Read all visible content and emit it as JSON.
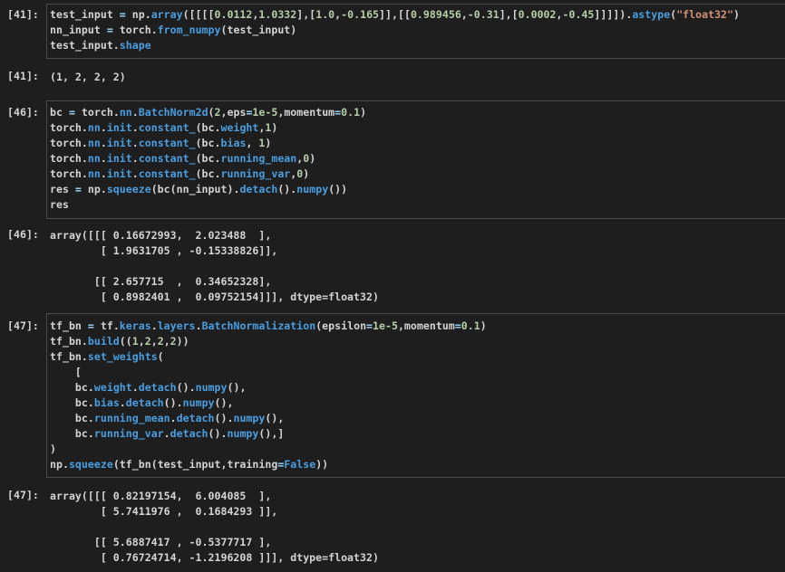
{
  "cells": [
    {
      "id": "in41",
      "prompt": "[41]:",
      "lines": [
        [
          [
            "test_input ",
            "def"
          ],
          [
            "=",
            "op"
          ],
          [
            " np.",
            "def"
          ],
          [
            "array",
            "fn"
          ],
          [
            "([[[[",
            "def"
          ],
          [
            "0.0112",
            "num"
          ],
          [
            ",",
            "def"
          ],
          [
            "1.0332",
            "num"
          ],
          [
            "],[",
            "def"
          ],
          [
            "1.0",
            "num"
          ],
          [
            ",",
            "def"
          ],
          [
            "-0.165",
            "num"
          ],
          [
            "]],[[",
            "def"
          ],
          [
            "0.989456",
            "num"
          ],
          [
            ",",
            "def"
          ],
          [
            "-0.31",
            "num"
          ],
          [
            "],[",
            "def"
          ],
          [
            "0.0002",
            "num"
          ],
          [
            ",",
            "def"
          ],
          [
            "-0.45",
            "num"
          ],
          [
            "]]]]).",
            "def"
          ],
          [
            "astype",
            "fn"
          ],
          [
            "(",
            "def"
          ],
          [
            "\"float32\"",
            "str"
          ],
          [
            ")",
            "def"
          ]
        ],
        [
          [
            "nn_input ",
            "def"
          ],
          [
            "=",
            "op"
          ],
          [
            " torch.",
            "def"
          ],
          [
            "from_numpy",
            "fn"
          ],
          [
            "(test_input)",
            "def"
          ]
        ],
        [
          [
            "test_input.",
            "def"
          ],
          [
            "shape",
            "fn"
          ]
        ]
      ]
    },
    {
      "id": "out41",
      "prompt": "[41]:",
      "lines": [
        "(1, 2, 2, 2)"
      ]
    },
    {
      "id": "in46",
      "prompt": "[46]:",
      "lines": [
        [
          [
            "bc ",
            "def"
          ],
          [
            "=",
            "op"
          ],
          [
            " torch.",
            "def"
          ],
          [
            "nn",
            "fn"
          ],
          [
            ".",
            "def"
          ],
          [
            "BatchNorm2d",
            "fn"
          ],
          [
            "(",
            "def"
          ],
          [
            "2",
            "num"
          ],
          [
            ",eps",
            "def"
          ],
          [
            "=",
            "op"
          ],
          [
            "1e-5",
            "num"
          ],
          [
            ",momentum",
            "def"
          ],
          [
            "=",
            "op"
          ],
          [
            "0.1",
            "num"
          ],
          [
            ")",
            "def"
          ]
        ],
        [
          [
            "torch.",
            "def"
          ],
          [
            "nn",
            "fn"
          ],
          [
            ".",
            "def"
          ],
          [
            "init",
            "fn"
          ],
          [
            ".",
            "def"
          ],
          [
            "constant_",
            "fn"
          ],
          [
            "(bc.",
            "def"
          ],
          [
            "weight",
            "fn"
          ],
          [
            ",",
            "def"
          ],
          [
            "1",
            "num"
          ],
          [
            ")",
            "def"
          ]
        ],
        [
          [
            "torch.",
            "def"
          ],
          [
            "nn",
            "fn"
          ],
          [
            ".",
            "def"
          ],
          [
            "init",
            "fn"
          ],
          [
            ".",
            "def"
          ],
          [
            "constant_",
            "fn"
          ],
          [
            "(bc.",
            "def"
          ],
          [
            "bias",
            "fn"
          ],
          [
            ", ",
            "def"
          ],
          [
            "1",
            "num"
          ],
          [
            ")",
            "def"
          ]
        ],
        [
          [
            "torch.",
            "def"
          ],
          [
            "nn",
            "fn"
          ],
          [
            ".",
            "def"
          ],
          [
            "init",
            "fn"
          ],
          [
            ".",
            "def"
          ],
          [
            "constant_",
            "fn"
          ],
          [
            "(bc.",
            "def"
          ],
          [
            "running_mean",
            "fn"
          ],
          [
            ",",
            "def"
          ],
          [
            "0",
            "num"
          ],
          [
            ")",
            "def"
          ]
        ],
        [
          [
            "torch.",
            "def"
          ],
          [
            "nn",
            "fn"
          ],
          [
            ".",
            "def"
          ],
          [
            "init",
            "fn"
          ],
          [
            ".",
            "def"
          ],
          [
            "constant_",
            "fn"
          ],
          [
            "(bc.",
            "def"
          ],
          [
            "running_var",
            "fn"
          ],
          [
            ",",
            "def"
          ],
          [
            "0",
            "num"
          ],
          [
            ")",
            "def"
          ]
        ],
        [
          [
            "res ",
            "def"
          ],
          [
            "=",
            "op"
          ],
          [
            " np.",
            "def"
          ],
          [
            "squeeze",
            "fn"
          ],
          [
            "(bc(nn_input).",
            "def"
          ],
          [
            "detach",
            "fn"
          ],
          [
            "().",
            "def"
          ],
          [
            "numpy",
            "fn"
          ],
          [
            "())",
            "def"
          ]
        ],
        [
          [
            "res",
            "def"
          ]
        ]
      ]
    },
    {
      "id": "out46",
      "prompt": "[46]:",
      "lines": [
        "array([[[ 0.16672993,  2.023488  ],",
        "        [ 1.9631705 , -0.15338826]],",
        "",
        "       [[ 2.657715  ,  0.34652328],",
        "        [ 0.8982401 ,  0.09752154]]], dtype=float32)"
      ]
    },
    {
      "id": "in47",
      "prompt": "[47]:",
      "lines": [
        [
          [
            "tf_bn ",
            "def"
          ],
          [
            "=",
            "op"
          ],
          [
            " tf.",
            "def"
          ],
          [
            "keras",
            "fn"
          ],
          [
            ".",
            "def"
          ],
          [
            "layers",
            "fn"
          ],
          [
            ".",
            "def"
          ],
          [
            "BatchNormalization",
            "fn"
          ],
          [
            "(epsilon",
            "def"
          ],
          [
            "=",
            "op"
          ],
          [
            "1e-5",
            "num"
          ],
          [
            ",momentum",
            "def"
          ],
          [
            "=",
            "op"
          ],
          [
            "0.1",
            "num"
          ],
          [
            ")",
            "def"
          ]
        ],
        [
          [
            "tf_bn.",
            "def"
          ],
          [
            "build",
            "fn"
          ],
          [
            "((",
            "def"
          ],
          [
            "1",
            "num"
          ],
          [
            ",",
            "def"
          ],
          [
            "2",
            "num"
          ],
          [
            ",",
            "def"
          ],
          [
            "2",
            "num"
          ],
          [
            ",",
            "def"
          ],
          [
            "2",
            "num"
          ],
          [
            "))",
            "def"
          ]
        ],
        [
          [
            "tf_bn.",
            "def"
          ],
          [
            "set_weights",
            "fn"
          ],
          [
            "(",
            "def"
          ]
        ],
        [
          [
            "    [",
            "def"
          ]
        ],
        [
          [
            "    bc.",
            "def"
          ],
          [
            "weight",
            "fn"
          ],
          [
            ".",
            "def"
          ],
          [
            "detach",
            "fn"
          ],
          [
            "().",
            "def"
          ],
          [
            "numpy",
            "fn"
          ],
          [
            "(),",
            "def"
          ]
        ],
        [
          [
            "    bc.",
            "def"
          ],
          [
            "bias",
            "fn"
          ],
          [
            ".",
            "def"
          ],
          [
            "detach",
            "fn"
          ],
          [
            "().",
            "def"
          ],
          [
            "numpy",
            "fn"
          ],
          [
            "(),",
            "def"
          ]
        ],
        [
          [
            "    bc.",
            "def"
          ],
          [
            "running_mean",
            "fn"
          ],
          [
            ".",
            "def"
          ],
          [
            "detach",
            "fn"
          ],
          [
            "().",
            "def"
          ],
          [
            "numpy",
            "fn"
          ],
          [
            "(),",
            "def"
          ]
        ],
        [
          [
            "    bc.",
            "def"
          ],
          [
            "running_var",
            "fn"
          ],
          [
            ".",
            "def"
          ],
          [
            "detach",
            "fn"
          ],
          [
            "().",
            "def"
          ],
          [
            "numpy",
            "fn"
          ],
          [
            "(),]",
            "def"
          ]
        ],
        [
          [
            ")",
            "def"
          ]
        ],
        [
          [
            "np.",
            "def"
          ],
          [
            "squeeze",
            "fn"
          ],
          [
            "(tf_bn(test_input,training",
            "def"
          ],
          [
            "=",
            "op"
          ],
          [
            "False",
            "kw"
          ],
          [
            "))",
            "def"
          ]
        ]
      ]
    },
    {
      "id": "out47",
      "prompt": "[47]:",
      "lines": [
        "array([[[ 0.82197154,  6.004085  ],",
        "        [ 5.7411976 ,  0.1684293 ]],",
        "",
        "       [[ 5.6887417 , -0.5377717 ],",
        "        [ 0.76724714, -1.2196208 ]]], dtype=float32)"
      ]
    }
  ]
}
